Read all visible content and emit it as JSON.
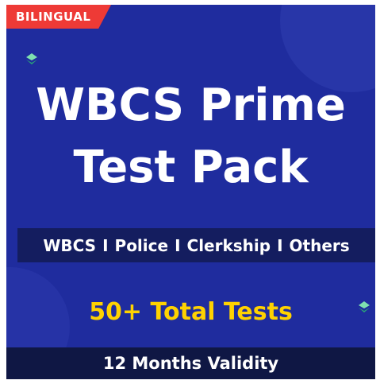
{
  "badge": {
    "label": "BILINGUAL"
  },
  "title": {
    "line1": "WBCS Prime",
    "line2": "Test Pack"
  },
  "categories": {
    "items": [
      "WBCS",
      "Police",
      "Clerkship",
      "Others"
    ],
    "separator": "I"
  },
  "tests": {
    "label": "50+ Total Tests"
  },
  "validity": {
    "label": "12 Months Validity"
  },
  "colors": {
    "background": "#1f2c9e",
    "badge": "#ee3a36",
    "accent": "#ffd200",
    "category_bar": "#141d5f",
    "footer_bar": "#0f1744",
    "gem": "#3fbf8a"
  },
  "icons": [
    "gem-icon",
    "gem-icon"
  ]
}
